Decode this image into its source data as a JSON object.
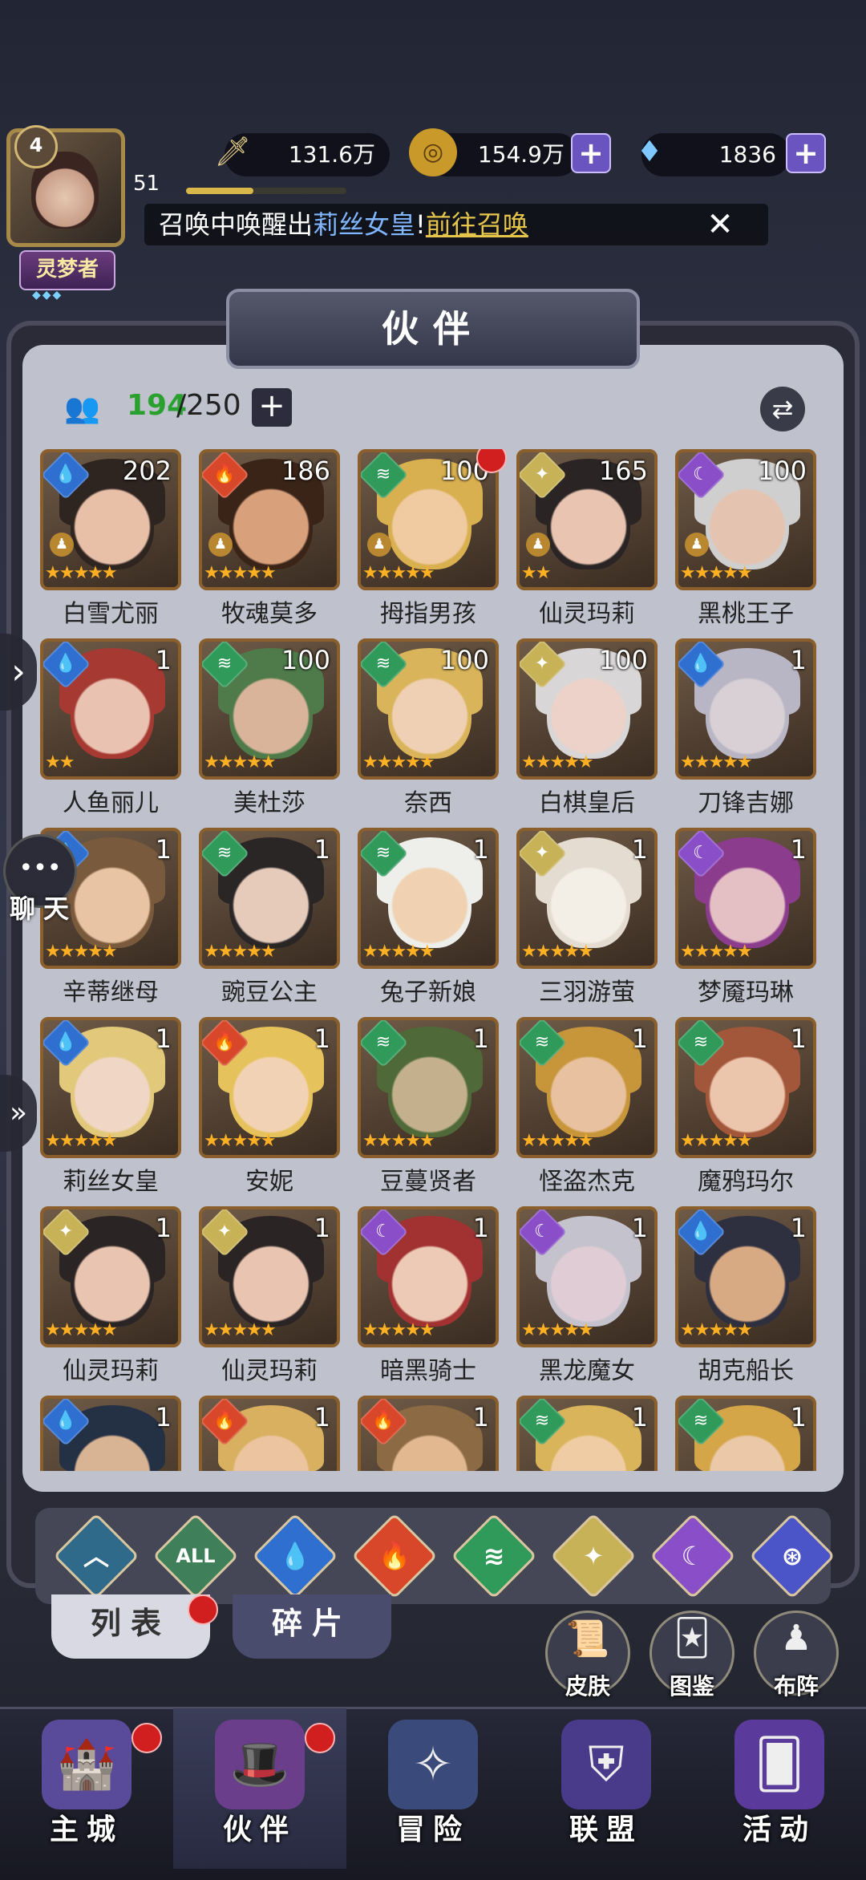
{
  "player": {
    "rank_level": "4",
    "level": "51",
    "xp_fraction": 0.42,
    "title": "灵梦者"
  },
  "resources": {
    "power": "131.6万",
    "gold": "154.9万",
    "gems": "1836"
  },
  "notice": {
    "prefix": "召唤中唤醒出",
    "highlight": "莉丝女皇",
    "sep": "!",
    "link": "前往召唤"
  },
  "panel": {
    "title": "伙伴",
    "count_current": "194",
    "count_sep": "/",
    "count_max": "250"
  },
  "heroes": [
    {
      "name": "白雪尤丽",
      "value": "202",
      "element": "water",
      "stars": 5,
      "lock": true,
      "dot": false,
      "skin": "#e8c0a8",
      "hair": "#2e2420"
    },
    {
      "name": "牧魂莫多",
      "value": "186",
      "element": "fire",
      "stars": 5,
      "lock": true,
      "dot": false,
      "skin": "#d9a07c",
      "hair": "#3a2418"
    },
    {
      "name": "拇指男孩",
      "value": "100",
      "element": "wind",
      "stars": 5,
      "lock": true,
      "dot": true,
      "skin": "#f0caa0",
      "hair": "#d8b050"
    },
    {
      "name": "仙灵玛莉",
      "value": "165",
      "element": "light",
      "stars": 2,
      "lock": true,
      "dot": false,
      "skin": "#e9c4b0",
      "hair": "#2a2424"
    },
    {
      "name": "黑桃王子",
      "value": "100",
      "element": "dark",
      "stars": 5,
      "lock": true,
      "dot": false,
      "skin": "#e4c4b0",
      "hair": "#cfcfcf"
    },
    {
      "name": "人鱼丽儿",
      "value": "1",
      "element": "water",
      "stars": 2,
      "lock": false,
      "dot": false,
      "skin": "#eac2b2",
      "hair": "#a63a32"
    },
    {
      "name": "美杜莎",
      "value": "100",
      "element": "wind",
      "stars": 5,
      "lock": false,
      "dot": false,
      "skin": "#d9b49a",
      "hair": "#4f7a4a"
    },
    {
      "name": "奈西",
      "value": "100",
      "element": "wind",
      "stars": 5,
      "lock": false,
      "dot": false,
      "skin": "#f0d0b4",
      "hair": "#d9b45a"
    },
    {
      "name": "白棋皇后",
      "value": "100",
      "element": "light",
      "stars": 5,
      "lock": false,
      "dot": false,
      "skin": "#ecd2c8",
      "hair": "#d8d6d6"
    },
    {
      "name": "刀锋吉娜",
      "value": "1",
      "element": "water",
      "stars": 5,
      "lock": false,
      "dot": false,
      "skin": "#d8d0d4",
      "hair": "#b8b6c4"
    },
    {
      "name": "辛蒂继母",
      "value": "1",
      "element": "water",
      "stars": 5,
      "lock": false,
      "dot": false,
      "skin": "#e8c4a4",
      "hair": "#7a5a3c"
    },
    {
      "name": "豌豆公主",
      "value": "1",
      "element": "wind",
      "stars": 5,
      "lock": false,
      "dot": false,
      "skin": "#e6cbbb",
      "hair": "#2a2626"
    },
    {
      "name": "兔子新娘",
      "value": "1",
      "element": "wind",
      "stars": 5,
      "lock": false,
      "dot": false,
      "skin": "#f0d2b2",
      "hair": "#eeeeea"
    },
    {
      "name": "三羽游萤",
      "value": "1",
      "element": "light",
      "stars": 5,
      "lock": false,
      "dot": false,
      "skin": "#f3efe6",
      "hair": "#e4dcd0"
    },
    {
      "name": "梦魇玛琳",
      "value": "1",
      "element": "dark",
      "stars": 5,
      "lock": false,
      "dot": false,
      "skin": "#e4c0c4",
      "hair": "#8c3c8c"
    },
    {
      "name": "莉丝女皇",
      "value": "1",
      "element": "water",
      "stars": 5,
      "lock": false,
      "dot": false,
      "skin": "#f0d6c4",
      "hair": "#e2c87a"
    },
    {
      "name": "安妮",
      "value": "1",
      "element": "fire",
      "stars": 5,
      "lock": false,
      "dot": false,
      "skin": "#f2d2b4",
      "hair": "#e6c25c"
    },
    {
      "name": "豆蔓贤者",
      "value": "1",
      "element": "wind",
      "stars": 5,
      "lock": false,
      "dot": false,
      "skin": "#c4b08c",
      "hair": "#4f6a38"
    },
    {
      "name": "怪盗杰克",
      "value": "1",
      "element": "wind",
      "stars": 5,
      "lock": false,
      "dot": false,
      "skin": "#e8c2a0",
      "hair": "#c8963a"
    },
    {
      "name": "魔鸦玛尔",
      "value": "1",
      "element": "wind",
      "stars": 5,
      "lock": false,
      "dot": false,
      "skin": "#ecc6ac",
      "hair": "#a2563a"
    },
    {
      "name": "仙灵玛莉",
      "value": "1",
      "element": "light",
      "stars": 5,
      "lock": false,
      "dot": false,
      "skin": "#e9c4b0",
      "hair": "#2a2424"
    },
    {
      "name": "仙灵玛莉",
      "value": "1",
      "element": "light",
      "stars": 5,
      "lock": false,
      "dot": false,
      "skin": "#e9c4b0",
      "hair": "#2a2424"
    },
    {
      "name": "暗黑骑士",
      "value": "1",
      "element": "dark",
      "stars": 5,
      "lock": false,
      "dot": false,
      "skin": "#eccab6",
      "hair": "#a23232"
    },
    {
      "name": "黑龙魔女",
      "value": "1",
      "element": "dark",
      "stars": 5,
      "lock": false,
      "dot": false,
      "skin": "#e0ccd4",
      "hair": "#c4c2cc"
    },
    {
      "name": "胡克船长",
      "value": "1",
      "element": "water",
      "stars": 5,
      "lock": false,
      "dot": false,
      "skin": "#d8aa84",
      "hair": "#2e3040"
    },
    {
      "name": "",
      "value": "1",
      "element": "water",
      "stars": 0,
      "lock": false,
      "dot": false,
      "skin": "#d8b494",
      "hair": "#243044"
    },
    {
      "name": "",
      "value": "1",
      "element": "fire",
      "stars": 0,
      "lock": false,
      "dot": false,
      "skin": "#ecc4a0",
      "hair": "#d8b060"
    },
    {
      "name": "",
      "value": "1",
      "element": "fire",
      "stars": 0,
      "lock": false,
      "dot": false,
      "skin": "#e2b890",
      "hair": "#8c6a44"
    },
    {
      "name": "",
      "value": "1",
      "element": "wind",
      "stars": 0,
      "lock": false,
      "dot": false,
      "skin": "#f0cca4",
      "hair": "#d9b45a"
    },
    {
      "name": "",
      "value": "1",
      "element": "wind",
      "stars": 0,
      "lock": false,
      "dot": false,
      "skin": "#eac8a8",
      "hair": "#d4a648"
    }
  ],
  "element_colors": {
    "water": "#2f6fd0",
    "fire": "#d8472a",
    "wind": "#2f9a5a",
    "light": "#c7b257",
    "dark": "#8a4fc8",
    "all": "#3f7f5a",
    "cosmic": "#4b55c8",
    "base": "#2f6a8a"
  },
  "element_glyphs": {
    "water": "💧",
    "fire": "🔥",
    "wind": "≋",
    "light": "✦",
    "dark": "☾",
    "all": "ALL",
    "cosmic": "⊛",
    "base": "︿"
  },
  "filters": [
    "base",
    "all",
    "water",
    "fire",
    "wind",
    "light",
    "dark",
    "cosmic"
  ],
  "tabs": {
    "list": "列表",
    "fragments": "碎片"
  },
  "side_buttons": {
    "skin": "皮肤",
    "codex": "图鉴",
    "formation": "布阵"
  },
  "chat_label": "聊天",
  "bottom_nav": [
    {
      "label": "主城",
      "icon": "castle-icon",
      "dot": true,
      "glyph": "🏰"
    },
    {
      "label": "伙伴",
      "icon": "witch-hat-icon",
      "dot": true,
      "glyph": "🎩"
    },
    {
      "label": "冒险",
      "icon": "compass-icon",
      "dot": false,
      "glyph": "✧"
    },
    {
      "label": "联盟",
      "icon": "shield-icon",
      "dot": false,
      "glyph": "⛨"
    },
    {
      "label": "活动",
      "icon": "cards-icon",
      "dot": false,
      "glyph": "🂠"
    }
  ]
}
